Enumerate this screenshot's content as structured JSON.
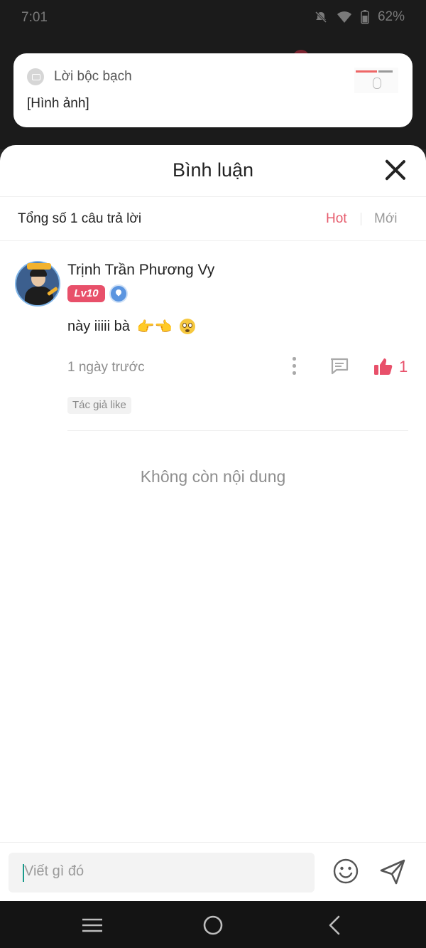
{
  "status_bar": {
    "time": "7:01",
    "battery": "62%"
  },
  "notification": {
    "title": "Lời bộc bạch",
    "text": "[Hình ảnh]"
  },
  "sheet": {
    "title": "Bình luận"
  },
  "summary": {
    "count_text": "Tổng số 1 câu trả lời",
    "sort_hot": "Hot",
    "sort_new": "Mới"
  },
  "comment": {
    "author": "Trịnh Trần Phương Vy",
    "level": "Lv10",
    "text": "này iiiii bà",
    "emoji": "👉👈",
    "time": "1 ngày trước",
    "likes": "1",
    "author_like": "Tác giả like"
  },
  "end_text": "Không còn nội dung",
  "composer": {
    "placeholder": "Viết gì đó"
  },
  "colors": {
    "accent": "#e65b6c",
    "like": "#e8506a",
    "text": "#222222",
    "muted": "#8e8e8e"
  }
}
